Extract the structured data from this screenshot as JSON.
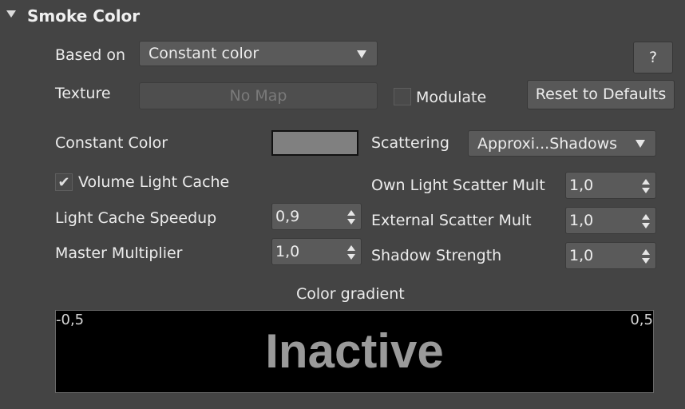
{
  "section": {
    "title": "Smoke Color"
  },
  "based_on": {
    "label": "Based on",
    "value": "Constant color"
  },
  "help_button": {
    "label": "?"
  },
  "texture": {
    "label": "Texture",
    "map_button": "No Map",
    "modulate_label": "Modulate",
    "modulate_checked": false
  },
  "reset_button": {
    "label": "Reset to Defaults"
  },
  "constant_color": {
    "label": "Constant Color",
    "color": "#808080"
  },
  "scattering": {
    "label": "Scattering",
    "value": "Approxi...Shadows"
  },
  "volume_light_cache": {
    "label": "Volume Light Cache",
    "checked": true,
    "check_glyph": "✔"
  },
  "own_light_scatter_mult": {
    "label": "Own Light Scatter Mult",
    "value": "1,0"
  },
  "light_cache_speedup": {
    "label": "Light Cache Speedup",
    "value": "0,9"
  },
  "external_scatter_mult": {
    "label": "External Scatter Mult",
    "value": "1,0"
  },
  "master_multiplier": {
    "label": "Master Multiplier",
    "value": "1,0"
  },
  "shadow_strength": {
    "label": "Shadow Strength",
    "value": "1,0"
  },
  "color_gradient": {
    "label": "Color gradient",
    "min": "-0,5",
    "max": "0,5",
    "status": "Inactive"
  },
  "colors": {
    "panel_bg": "#444444",
    "control_bg": "#5a5a5a",
    "gradient_bg": "#000000",
    "inactive_text": "#9a9a9a"
  }
}
